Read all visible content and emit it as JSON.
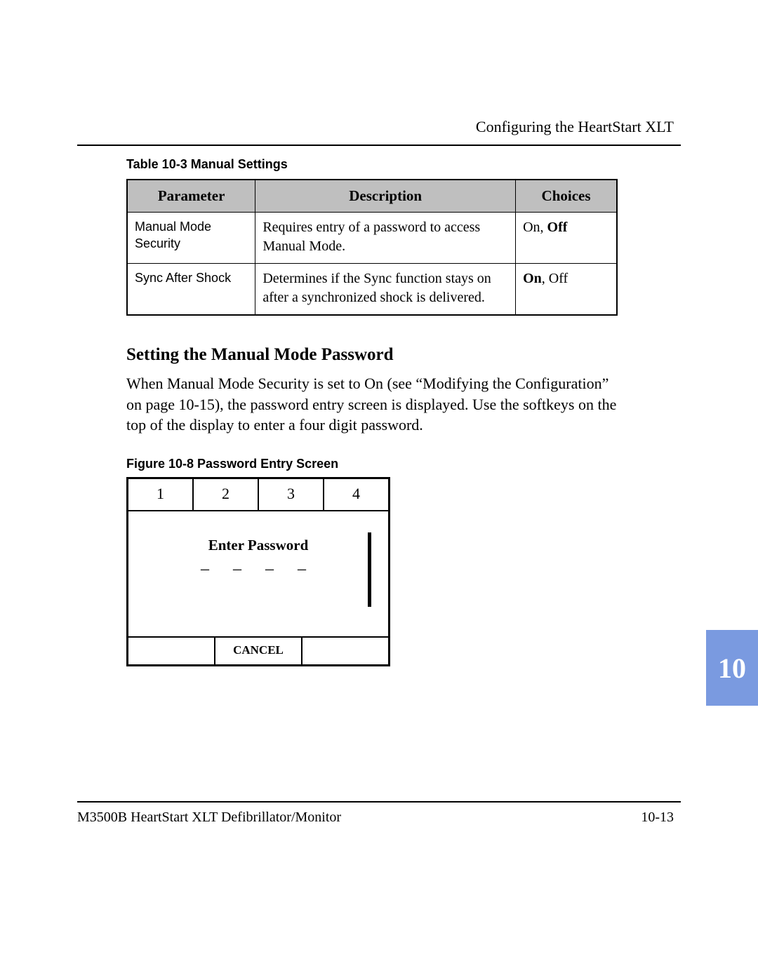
{
  "running_head": "Configuring the HeartStart XLT",
  "table_caption": "Table 10-3  Manual Settings",
  "table": {
    "headers": {
      "param": "Parameter",
      "desc": "Description",
      "choices": "Choices"
    },
    "rows": [
      {
        "param": "Manual Mode Security",
        "desc": "Requires entry of a password to access Manual Mode.",
        "choices_plain": "On, ",
        "choices_bold": "Off"
      },
      {
        "param": "Sync After Shock",
        "desc": "Determines if the Sync function stays on after a synchronized shock is delivered.",
        "choices_bold": "On",
        "choices_plain_after": ", Off"
      }
    ]
  },
  "section_heading": "Setting the Manual Mode Password",
  "body_para": "When Manual Mode Security is set to On (see “Modifying the Configuration” on page 10-15), the password entry screen is displayed. Use the softkeys on the top of the display to enter a four digit password.",
  "figure_caption": "Figure 10-8  Password Entry Screen",
  "pw_screen": {
    "digits": [
      "1",
      "2",
      "3",
      "4"
    ],
    "title": "Enter Password",
    "dashes": "–  –  –  –",
    "cancel": "CANCEL"
  },
  "chapter_tab": "10",
  "footer_left": "M3500B HeartStart XLT Defibrillator/Monitor",
  "footer_right": "10-13"
}
